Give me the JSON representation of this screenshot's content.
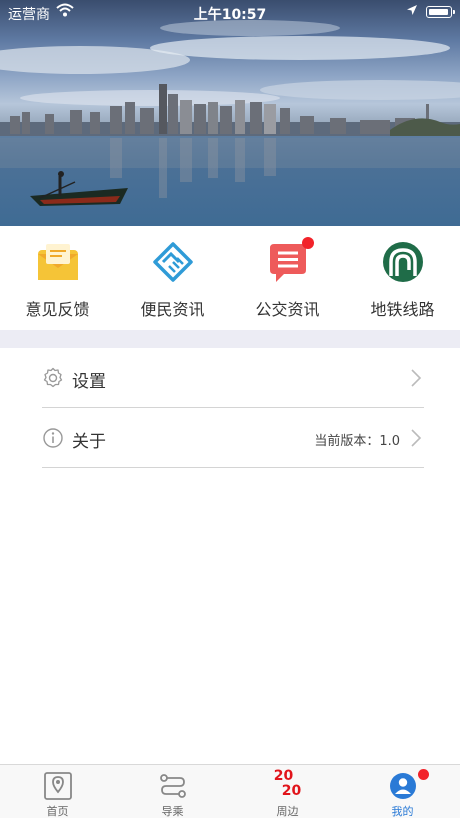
{
  "status_bar": {
    "carrier": "运营商",
    "time": "上午10:57",
    "icons": [
      "wifi-icon",
      "location-arrow-icon",
      "battery-icon"
    ]
  },
  "hero": {
    "image": "city-skyline-lake-photo"
  },
  "quick_menu": [
    {
      "label": "意见反馈",
      "icon": "feedback-envelope-icon",
      "color": "#f5c437",
      "badge": false
    },
    {
      "label": "便民资讯",
      "icon": "handshake-icon",
      "color": "#2f9bd7",
      "badge": false
    },
    {
      "label": "公交资讯",
      "icon": "message-icon",
      "color": "#ee5a5a",
      "badge": true
    },
    {
      "label": "地铁线路",
      "icon": "metro-logo-icon",
      "color": "#1f6c48",
      "badge": false
    }
  ],
  "settings_list": [
    {
      "label": "设置",
      "icon": "gear-icon",
      "value": ""
    },
    {
      "label": "关于",
      "icon": "info-icon",
      "value": "当前版本：1.0"
    }
  ],
  "tab_bar": [
    {
      "label": "首页",
      "icon": "map-pin-icon",
      "active": false,
      "badge": false
    },
    {
      "label": "导乘",
      "icon": "route-icon",
      "active": false,
      "badge": false
    },
    {
      "label": "周边",
      "icon": "2020-icon",
      "icon_text": [
        "20",
        "20"
      ],
      "active": false,
      "badge": false
    },
    {
      "label": "我的",
      "icon": "user-icon",
      "active": true,
      "badge": true
    }
  ],
  "colors": {
    "accent": "#2a7ad6",
    "badge": "#f2232a",
    "divider": "#ececf4"
  }
}
